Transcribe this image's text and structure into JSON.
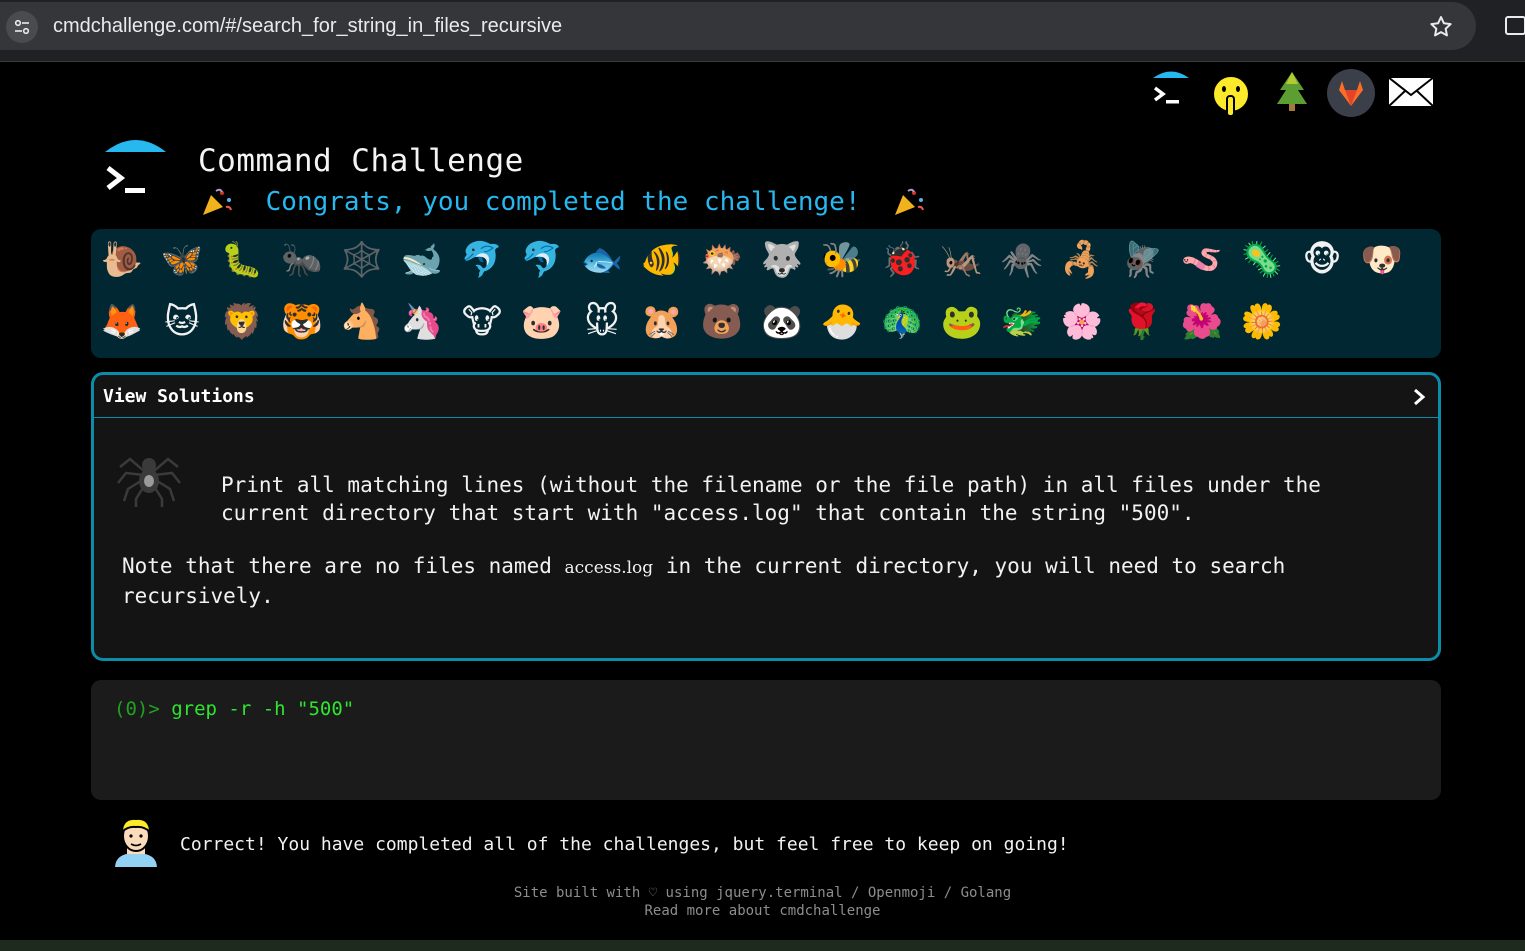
{
  "browser": {
    "url": "cmdchallenge.com/#/search_for_string_in_files_recursive"
  },
  "header": {
    "title": "Command Challenge",
    "congrats": "Congrats, you completed the challenge!"
  },
  "badges": {
    "row1": [
      "🐌",
      "🦋",
      "🐛",
      "🐜",
      "🕸️",
      "🐋",
      "🐬",
      "🐬",
      "🐟",
      "🐠",
      "🐡",
      "🐺",
      "🐝",
      "🐞",
      "🦗",
      "🕷️",
      "🦂",
      "🪰",
      "🪱",
      "🦠",
      "🐵",
      "🐶"
    ],
    "row2": [
      "🦊",
      "🐱",
      "🦁",
      "🐯",
      "🐴",
      "🦄",
      "🐮",
      "🐷",
      "🐭",
      "🐹",
      "🐻",
      "🐼",
      "🐣",
      "🦚",
      "🐸",
      "🐲",
      "🌸",
      "🌹",
      "🌺",
      "🌼"
    ]
  },
  "solutions": {
    "label": "View Solutions",
    "task": "Print all matching lines (without the filename or the file path) in all files under the\ncurrent directory that start with \"access.log\" that contain the string \"500\".",
    "note_before": "Note that there are no files named ",
    "note_code": "access.log",
    "note_after": " in the current directory, you will need to search recursively."
  },
  "terminal": {
    "prompt": "(0)>",
    "command": "grep -r -h \"500\""
  },
  "message": "Correct! You have completed all of the challenges, but feel free to keep on going!",
  "footer": {
    "line1": "Site built with ♡ using jquery.terminal / Openmoji / Golang",
    "line2": "Read more about cmdchallenge"
  },
  "colors": {
    "accent": "#27b8ef",
    "panel_border": "#0b8ca8",
    "badge_bg": "#012732",
    "prompt_green": "#2ee62e"
  }
}
